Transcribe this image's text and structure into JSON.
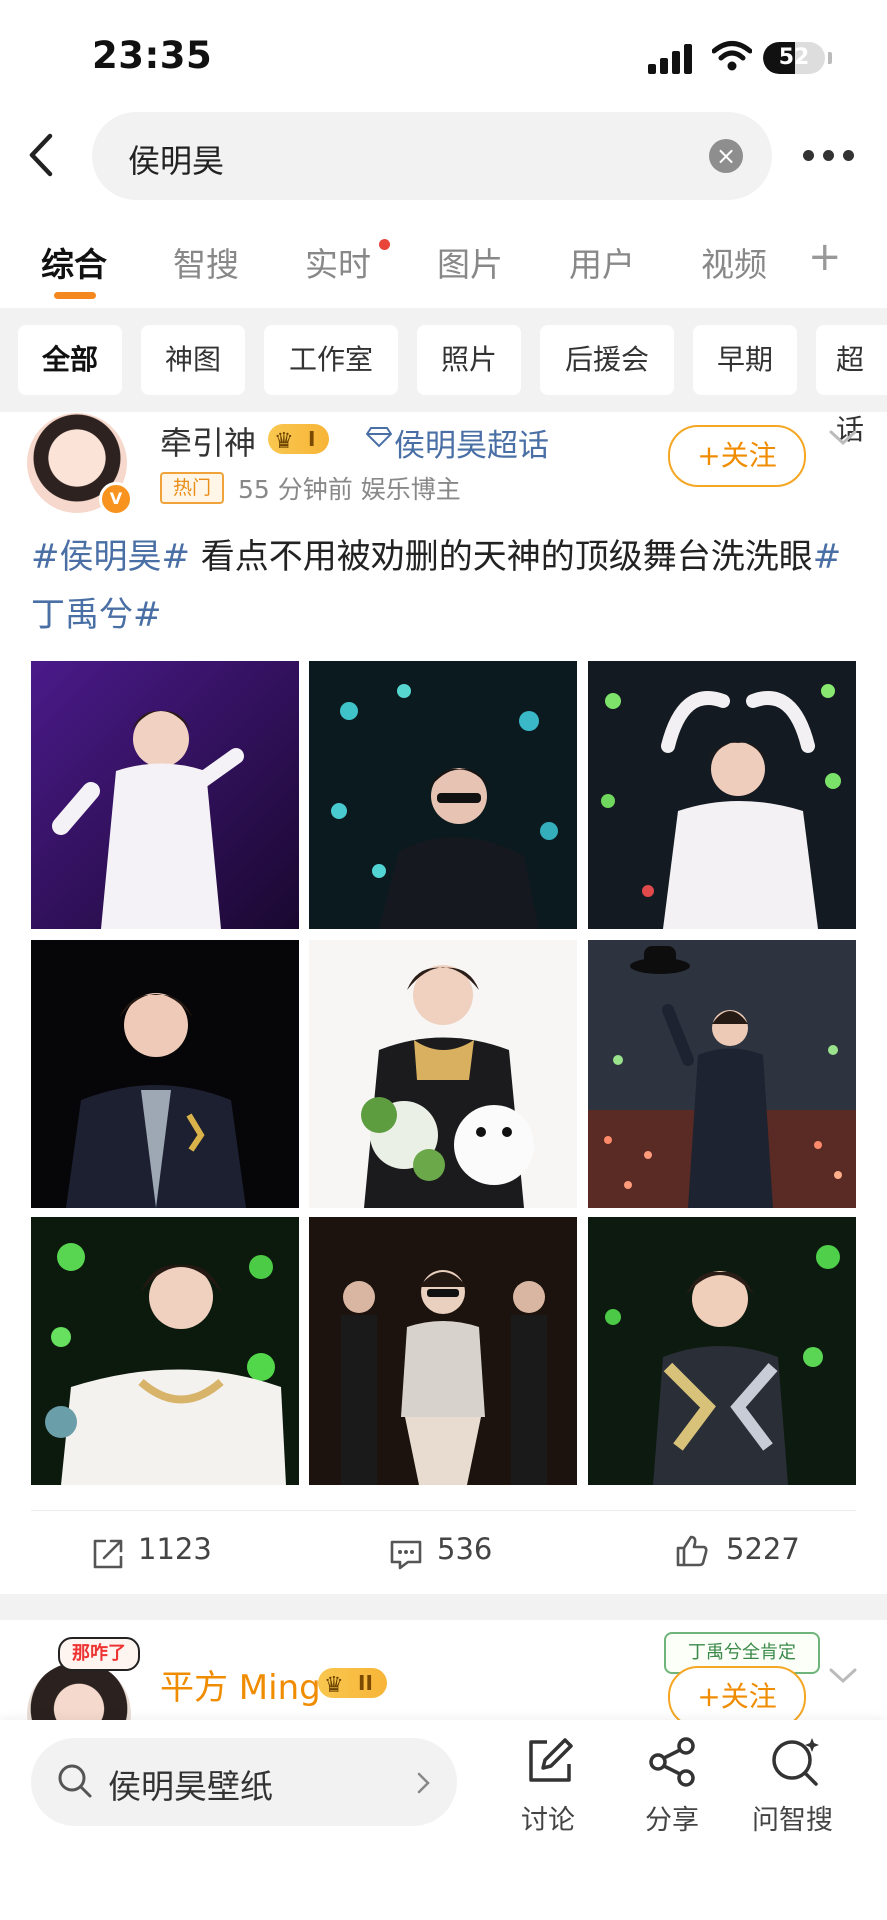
{
  "status_bar": {
    "time": "23:35",
    "battery": "52",
    "battery_level": 0.52
  },
  "search": {
    "query": "侯明昊"
  },
  "tabs": [
    {
      "label": "综合",
      "active": true
    },
    {
      "label": "智搜"
    },
    {
      "label": "实时",
      "has_dot": true
    },
    {
      "label": "图片"
    },
    {
      "label": "用户"
    },
    {
      "label": "视频"
    }
  ],
  "tab_add": "+",
  "filters": [
    {
      "label": "全部",
      "active": true
    },
    {
      "label": "神图"
    },
    {
      "label": "工作室"
    },
    {
      "label": "照片"
    },
    {
      "label": "后援会"
    },
    {
      "label": "早期"
    },
    {
      "label": "超话"
    }
  ],
  "post1": {
    "username": "牵引神",
    "level_badge": "I",
    "topic": "侯明昊超话",
    "hot_tag": "热门",
    "meta": "55 分钟前  娱乐博主",
    "follow_label": "+关注",
    "text": {
      "tag1": "#侯明昊#",
      "body": " 看点不用被劝删的天神的顶级舞台洗洗眼",
      "tag2": "#丁禹兮#"
    },
    "actions": {
      "repost": "1123",
      "comments": "536",
      "likes": "5227"
    }
  },
  "post2": {
    "username": "平方 Ming",
    "level_badge": "II",
    "sticker": "那咋了",
    "banner": "丁禹兮全肯定",
    "follow_label": "+关注"
  },
  "bottom_bar": {
    "search_text": "侯明昊壁纸",
    "discuss": "讨论",
    "share": "分享",
    "ask": "问智搜"
  },
  "colors": {
    "accent": "#f5871f",
    "link": "#4a6fa5",
    "follow": "#f08c00"
  }
}
